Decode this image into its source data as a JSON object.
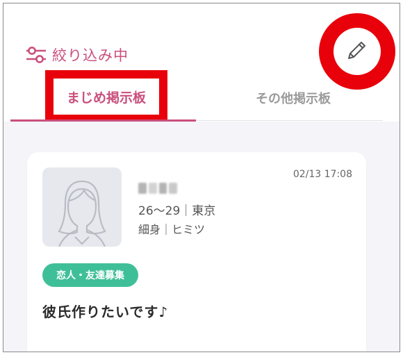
{
  "header": {
    "filter_label": "絞り込み中",
    "tabs": [
      {
        "label": "まじめ掲示板",
        "active": true
      },
      {
        "label": "その他掲示板",
        "active": false
      }
    ]
  },
  "post": {
    "user_name": "••••",
    "date": "02/13 17:08",
    "age_location": "26〜29｜東京",
    "body_type": "細身｜ヒミツ",
    "category": "恋人・友達募集",
    "title": "彼氏作りたいです♪"
  },
  "colors": {
    "accent": "#c94f7c",
    "highlight": "#e8000a",
    "badge": "#3fbf98",
    "background": "#f4f4f9"
  },
  "icons": {
    "filter": "sliders-icon",
    "edit": "pencil-icon",
    "avatar": "user-silhouette-icon"
  }
}
